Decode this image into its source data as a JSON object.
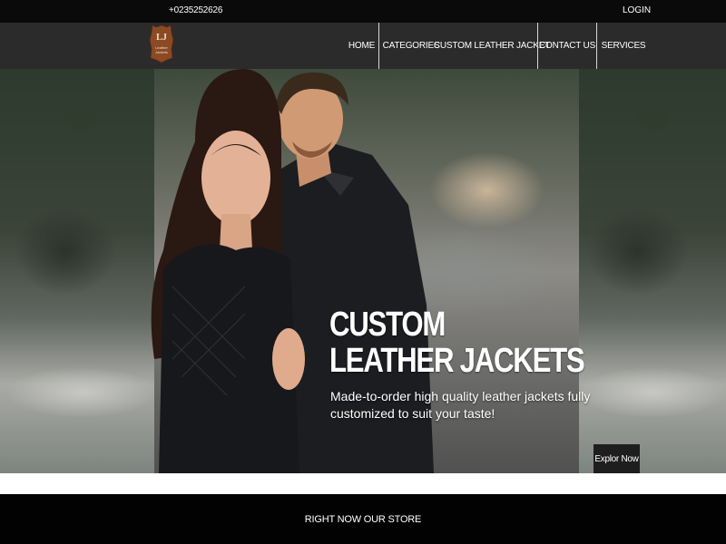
{
  "topbar": {
    "phone": "+0235252626",
    "login": "LOGIN"
  },
  "logo": {
    "text_line1": "Leather",
    "text_line2": "Jackets",
    "icon": "leather-hide-logo"
  },
  "nav": {
    "home": "HOME",
    "categories": "CATEGORIES",
    "custom": "CUSTOM LEATHER JACKET",
    "contact": "CONTACT US",
    "services": "SERVICES"
  },
  "hero": {
    "title_line1": "CUSTOM",
    "title_line2": "LEATHER JACKETS",
    "subtitle": "Made-to-order high quality leather jackets fully customized to suit your taste!",
    "explore": "Explor Now"
  },
  "store_band": {
    "text": "RIGHT NOW OUR STORE"
  },
  "colors": {
    "topbar": "#0a0a0a",
    "navbar": "#2b2b2b",
    "logo_brown": "#8b4a24",
    "band": "#020202"
  }
}
